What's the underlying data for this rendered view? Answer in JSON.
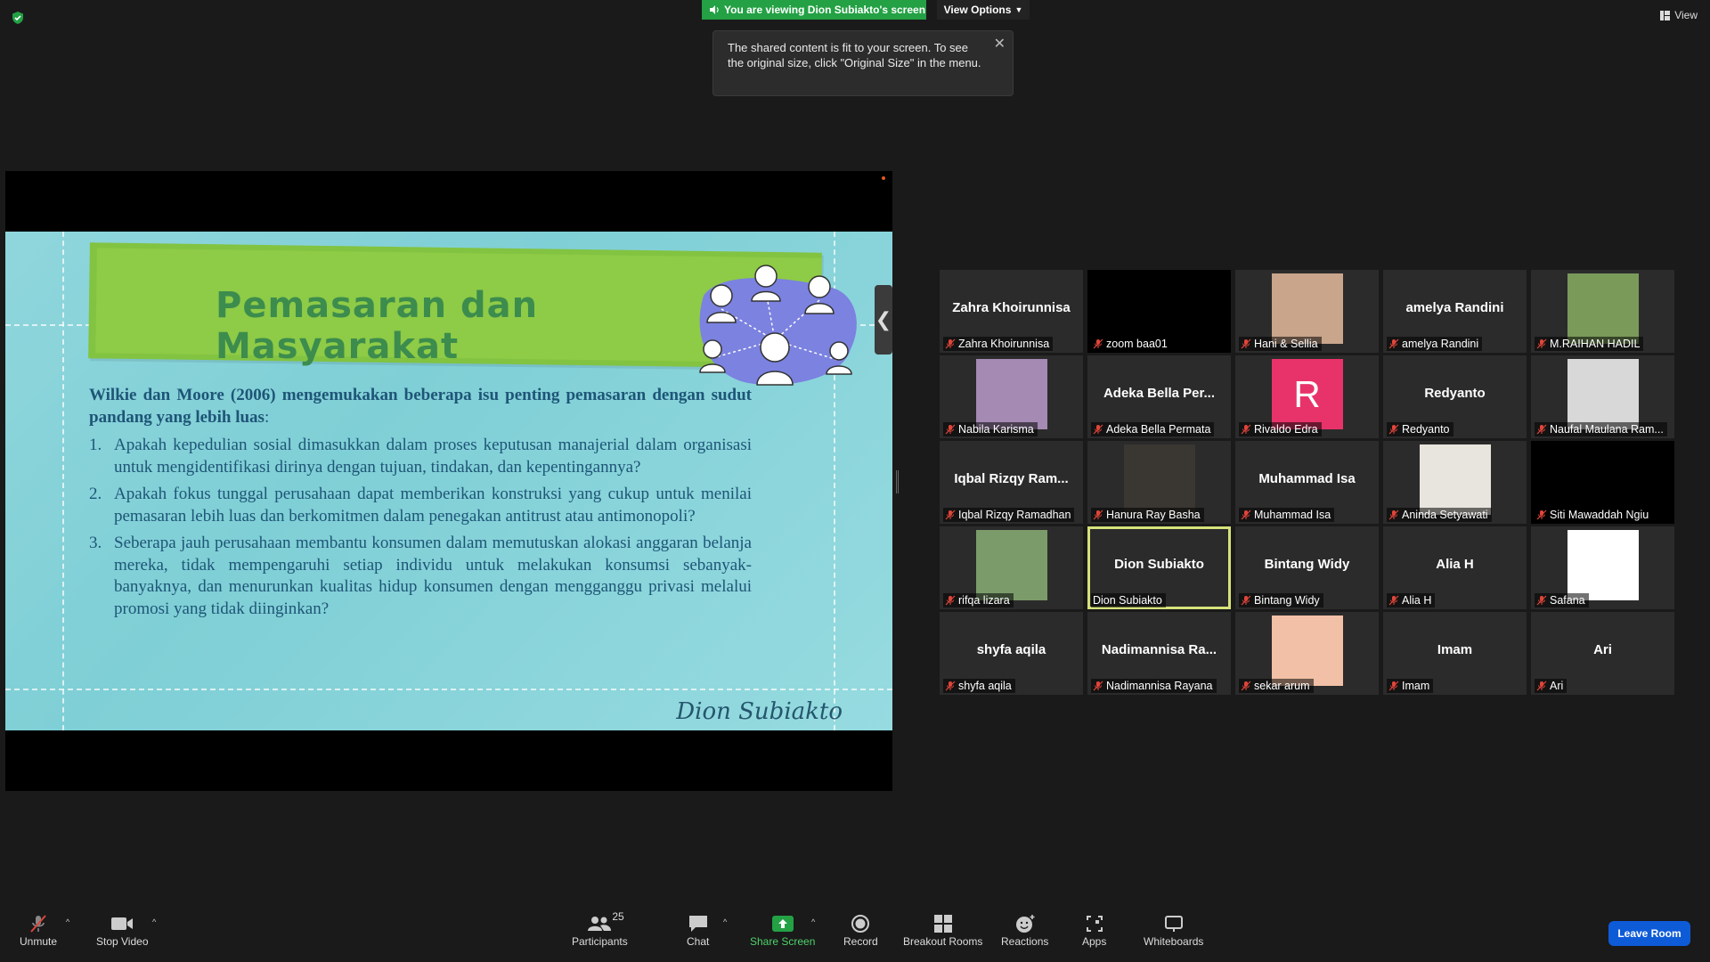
{
  "top": {
    "viewing_banner": "You are viewing Dion Subiakto's screen",
    "view_options": "View Options",
    "tooltip_text": "The shared content is fit to your screen. To see the original size, click \"Original Size\" in the menu.",
    "view_label": "View"
  },
  "slide": {
    "title": "Pemasaran dan Masyarakat",
    "intro_bold": "Wilkie dan Moore (2006) mengemukakan beberapa isu penting pemasaran dengan sudut pandang yang lebih luas",
    "intro_tail": ":",
    "items": [
      {
        "num": "1.",
        "text": "Apakah kepedulian sosial dimasukkan dalam proses keputusan manajerial dalam organisasi untuk mengidentifikasi dirinya dengan tujuan, tindakan, dan kepentingannya?"
      },
      {
        "num": "2.",
        "text": "Apakah fokus tunggal perusahaan dapat memberikan konstruksi yang cukup untuk menilai pemasaran lebih luas dan berkomitmen dalam penegakan antitrust atau antimonopoli?"
      },
      {
        "num": "3.",
        "text": "Seberapa jauh perusahaan membantu konsumen dalam memutuskan alokasi anggaran belanja mereka, tidak mempengaruhi setiap individu untuk melakukan konsumsi sebanyak-banyaknya, dan menurunkan kualitas hidup konsumen dengan mengganggu privasi melalui promosi yang tidak diinginkan?"
      }
    ],
    "signature": "Dion Subiakto"
  },
  "participants": [
    {
      "big": "Zahra Khoirunnisa",
      "label": "Zahra Khoirunnisa",
      "muted": true,
      "kind": "name"
    },
    {
      "big": "",
      "label": "zoom baa01",
      "muted": true,
      "kind": "black"
    },
    {
      "big": "",
      "label": "Hani & Sellia",
      "muted": true,
      "kind": "photo",
      "color": "#c9a58b"
    },
    {
      "big": "amelya Randini",
      "label": "amelya Randini",
      "muted": true,
      "kind": "name"
    },
    {
      "big": "",
      "label": "M.RAIHAN HADIL",
      "muted": true,
      "kind": "photo",
      "color": "#7a9a5a"
    },
    {
      "big": "",
      "label": "Nabila Karisma",
      "muted": true,
      "kind": "photo",
      "color": "#a58ab3"
    },
    {
      "big": "Adeka Bella Per...",
      "label": "Adeka Bella Permata",
      "muted": true,
      "kind": "name"
    },
    {
      "big": "R",
      "label": "Rivaldo Edra",
      "muted": true,
      "kind": "letter",
      "color": "#e8336a"
    },
    {
      "big": "Redyanto",
      "label": "Redyanto",
      "muted": true,
      "kind": "name"
    },
    {
      "big": "",
      "label": "Naufal Maulana Ram...",
      "muted": true,
      "kind": "photo",
      "color": "#d8d8d8"
    },
    {
      "big": "Iqbal Rizqy Ram...",
      "label": "Iqbal Rizqy Ramadhan",
      "muted": true,
      "kind": "name"
    },
    {
      "big": "",
      "label": "Hanura Ray Basha",
      "muted": true,
      "kind": "photo",
      "color": "#3a3632"
    },
    {
      "big": "Muhammad Isa",
      "label": "Muhammad Isa",
      "muted": true,
      "kind": "name"
    },
    {
      "big": "",
      "label": "Aninda Setyawati",
      "muted": true,
      "kind": "photo",
      "color": "#e8e4de"
    },
    {
      "big": "",
      "label": "Siti Mawaddah Ngiu",
      "muted": true,
      "kind": "black"
    },
    {
      "big": "",
      "label": "rifqa lizara",
      "muted": true,
      "kind": "photo",
      "color": "#7b9c6a"
    },
    {
      "big": "Dion Subiakto",
      "label": "Dion Subiakto",
      "muted": false,
      "kind": "name",
      "active": true
    },
    {
      "big": "Bintang Widy",
      "label": "Bintang Widy",
      "muted": true,
      "kind": "name"
    },
    {
      "big": "Alia H",
      "label": "Alia H",
      "muted": true,
      "kind": "name"
    },
    {
      "big": "",
      "label": "Safana",
      "muted": true,
      "kind": "photo",
      "color": "#ffffff"
    },
    {
      "big": "shyfa aqila",
      "label": "shyfa aqila",
      "muted": true,
      "kind": "name"
    },
    {
      "big": "Nadimannisa Ra...",
      "label": "Nadimannisa Rayana",
      "muted": true,
      "kind": "name"
    },
    {
      "big": "",
      "label": "sekar arum",
      "muted": true,
      "kind": "photo",
      "color": "#f2c0a6"
    },
    {
      "big": "Imam",
      "label": "Imam",
      "muted": true,
      "kind": "name"
    },
    {
      "big": "Ari",
      "label": "Ari",
      "muted": true,
      "kind": "name"
    }
  ],
  "toolbar": {
    "unmute": "Unmute",
    "stop_video": "Stop Video",
    "participants": "Participants",
    "participants_count": "25",
    "chat": "Chat",
    "share_screen": "Share Screen",
    "record": "Record",
    "breakout": "Breakout Rooms",
    "reactions": "Reactions",
    "apps": "Apps",
    "whiteboards": "Whiteboards",
    "leave": "Leave Room"
  },
  "colors": {
    "share_green": "#23a144",
    "leave_blue": "#0e5bd8",
    "active_speaker": "#d6e27a",
    "mute_red": "#e0453a"
  }
}
